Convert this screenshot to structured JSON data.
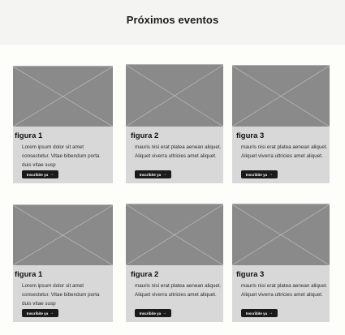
{
  "header": {
    "title": "Próximos eventos"
  },
  "cards": [
    {
      "title": "figura 1",
      "text": "Lorem ipsum dolor sit amet consectetur. Vitae bibendum porta duis vitae susp",
      "button": "Inscribite ya",
      "image_icon": "image-placeholder-icon"
    },
    {
      "title": "figura 2",
      "text": "mauris nisi erat platea aenean aliquet. Aliquet viverra ultricies amet aliquet.",
      "button": "Inscribite ya",
      "image_icon": "image-placeholder-icon"
    },
    {
      "title": "figura 3",
      "text": "mauris nisi erat platea aenean aliquet. Aliquet viverra ultricies amet aliquet.",
      "button": "Inscribite ya",
      "image_icon": "image-placeholder-icon"
    },
    {
      "title": "figura 1",
      "text": "Lorem ipsum dolor sit amet consectetur. Vitae bibendum porta duis vitae susp",
      "button": "Inscribite ya",
      "image_icon": "image-placeholder-icon"
    },
    {
      "title": "figura 2",
      "text": "mauris nisi erat platea aenean aliquet. Aliquet viverra ultricies amet aliquet.",
      "button": "Inscribite ya",
      "image_icon": "image-placeholder-icon"
    },
    {
      "title": "figura 3",
      "text": "mauris nisi erat platea aenean aliquet. Aliquet viverra ultricies amet aliquet.",
      "button": "Inscribite ya",
      "image_icon": "image-placeholder-icon"
    }
  ],
  "colors": {
    "card_bg": "#d8d8d8",
    "placeholder": "#8a8a8a",
    "button": "#1a1a1a",
    "header_bg": "#f4f4f2"
  }
}
